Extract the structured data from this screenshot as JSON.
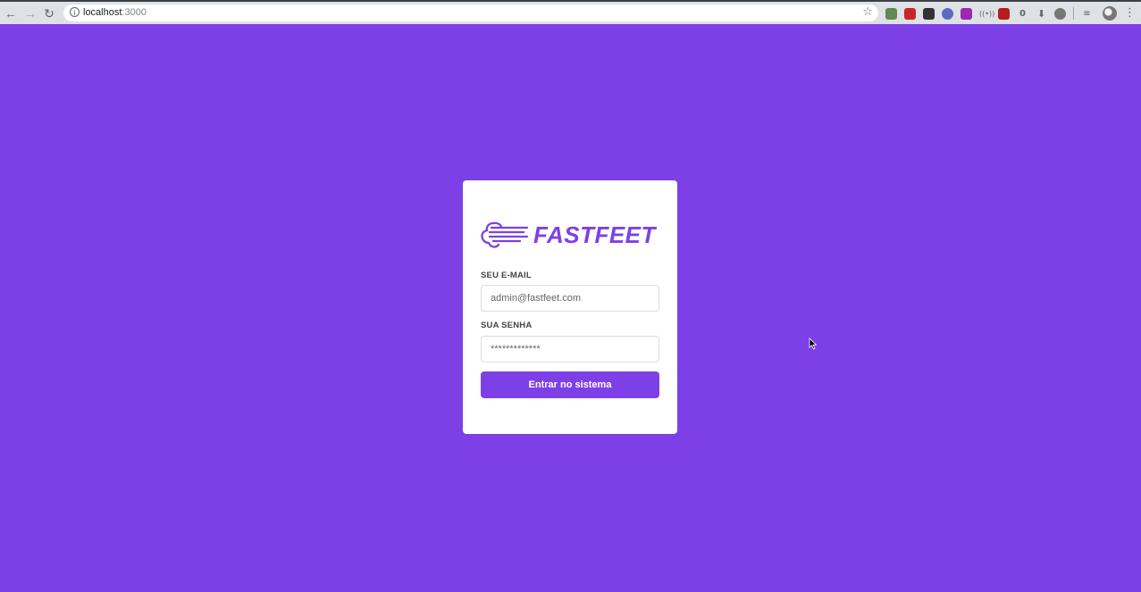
{
  "browser": {
    "url_host": "localhost",
    "url_port": ":3000"
  },
  "login": {
    "brand": "FASTFEET",
    "email_label": "SEU E-MAIL",
    "email_value": "admin@fastfeet.com",
    "password_label": "SUA SENHA",
    "password_value": "*************",
    "submit_label": "Entrar no sistema"
  },
  "colors": {
    "brand_purple": "#7d40e7",
    "card_background": "#ffffff",
    "label_text": "#444444"
  }
}
